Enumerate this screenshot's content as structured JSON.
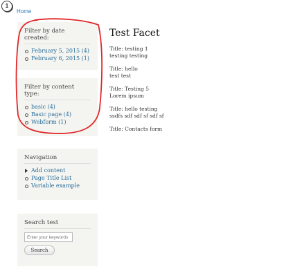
{
  "step_badge": "1",
  "breadcrumb": {
    "home": "Home"
  },
  "sidebar": {
    "date_block": {
      "title": "Filter by date created:",
      "items": [
        {
          "label": "February 5, 2015 (4)"
        },
        {
          "label": "February 6, 2015 (1)"
        }
      ]
    },
    "type_block": {
      "title": "Filter by content type:",
      "items": [
        {
          "label": "basic (4)"
        },
        {
          "label": "Basic page (4)"
        },
        {
          "label": "Webform (1)"
        }
      ]
    },
    "navigation": {
      "title": "Navigation",
      "items": [
        {
          "label": "Add content"
        },
        {
          "label": "Page Title List"
        },
        {
          "label": "Variable example"
        }
      ]
    },
    "search": {
      "title": "Search test",
      "placeholder": "Enter your keywords",
      "button": "Search"
    }
  },
  "main": {
    "title": "Test Facet",
    "results": [
      {
        "title": "Title: testing 1",
        "body": "testing testing"
      },
      {
        "title": "Title: hello",
        "body": "test test"
      },
      {
        "title": "Title: Testing 5",
        "body": "Lorem ipsum"
      },
      {
        "title": "Title: hello testing",
        "body": "ssdfs sdf sdf sf sdf sf"
      },
      {
        "title": "Title: Contacts form",
        "body": ""
      }
    ]
  },
  "colors": {
    "link": "#2a6f9b",
    "annotation": "#e0282a",
    "block_bg": "#f4f4f0"
  }
}
